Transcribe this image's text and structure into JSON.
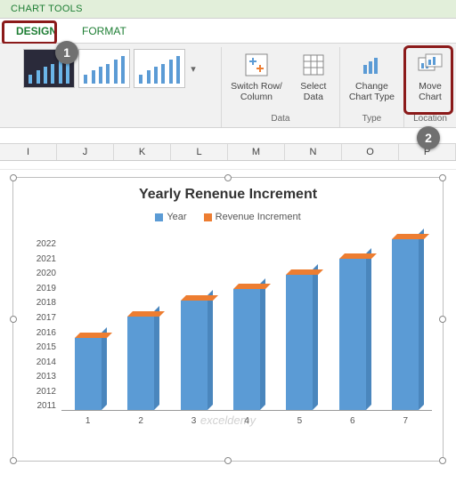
{
  "header": {
    "tools_label": "CHART TOOLS"
  },
  "tabs": {
    "design": "DESIGN",
    "format": "FORMAT"
  },
  "ribbon": {
    "switch_row": "Switch Row/\nColumn",
    "select_data": "Select\nData",
    "change_type": "Change\nChart Type",
    "move_chart": "Move\nChart",
    "group_data": "Data",
    "group_type": "Type",
    "group_location": "Location"
  },
  "annotations": {
    "one": "1",
    "two": "2"
  },
  "columns": [
    "I",
    "J",
    "K",
    "L",
    "M",
    "N",
    "O",
    "P"
  ],
  "chart_data": {
    "type": "bar",
    "title": "Yearly Renenue Increment",
    "series": [
      {
        "name": "Year",
        "color": "#5b9bd5"
      },
      {
        "name": "Revenue Increment",
        "color": "#ed7d31"
      }
    ],
    "categories": [
      "1",
      "2",
      "3",
      "4",
      "5",
      "6",
      "7"
    ],
    "values": [
      2015.5,
      2016.8,
      2017.8,
      2018.5,
      2019.4,
      2020.4,
      2021.6
    ],
    "ylim": [
      2011,
      2022
    ],
    "y_ticks": [
      "2011",
      "2012",
      "2013",
      "2014",
      "2015",
      "2016",
      "2017",
      "2018",
      "2019",
      "2020",
      "2021",
      "2022"
    ],
    "xlabel": "",
    "ylabel": ""
  },
  "watermark": "exceldemy"
}
